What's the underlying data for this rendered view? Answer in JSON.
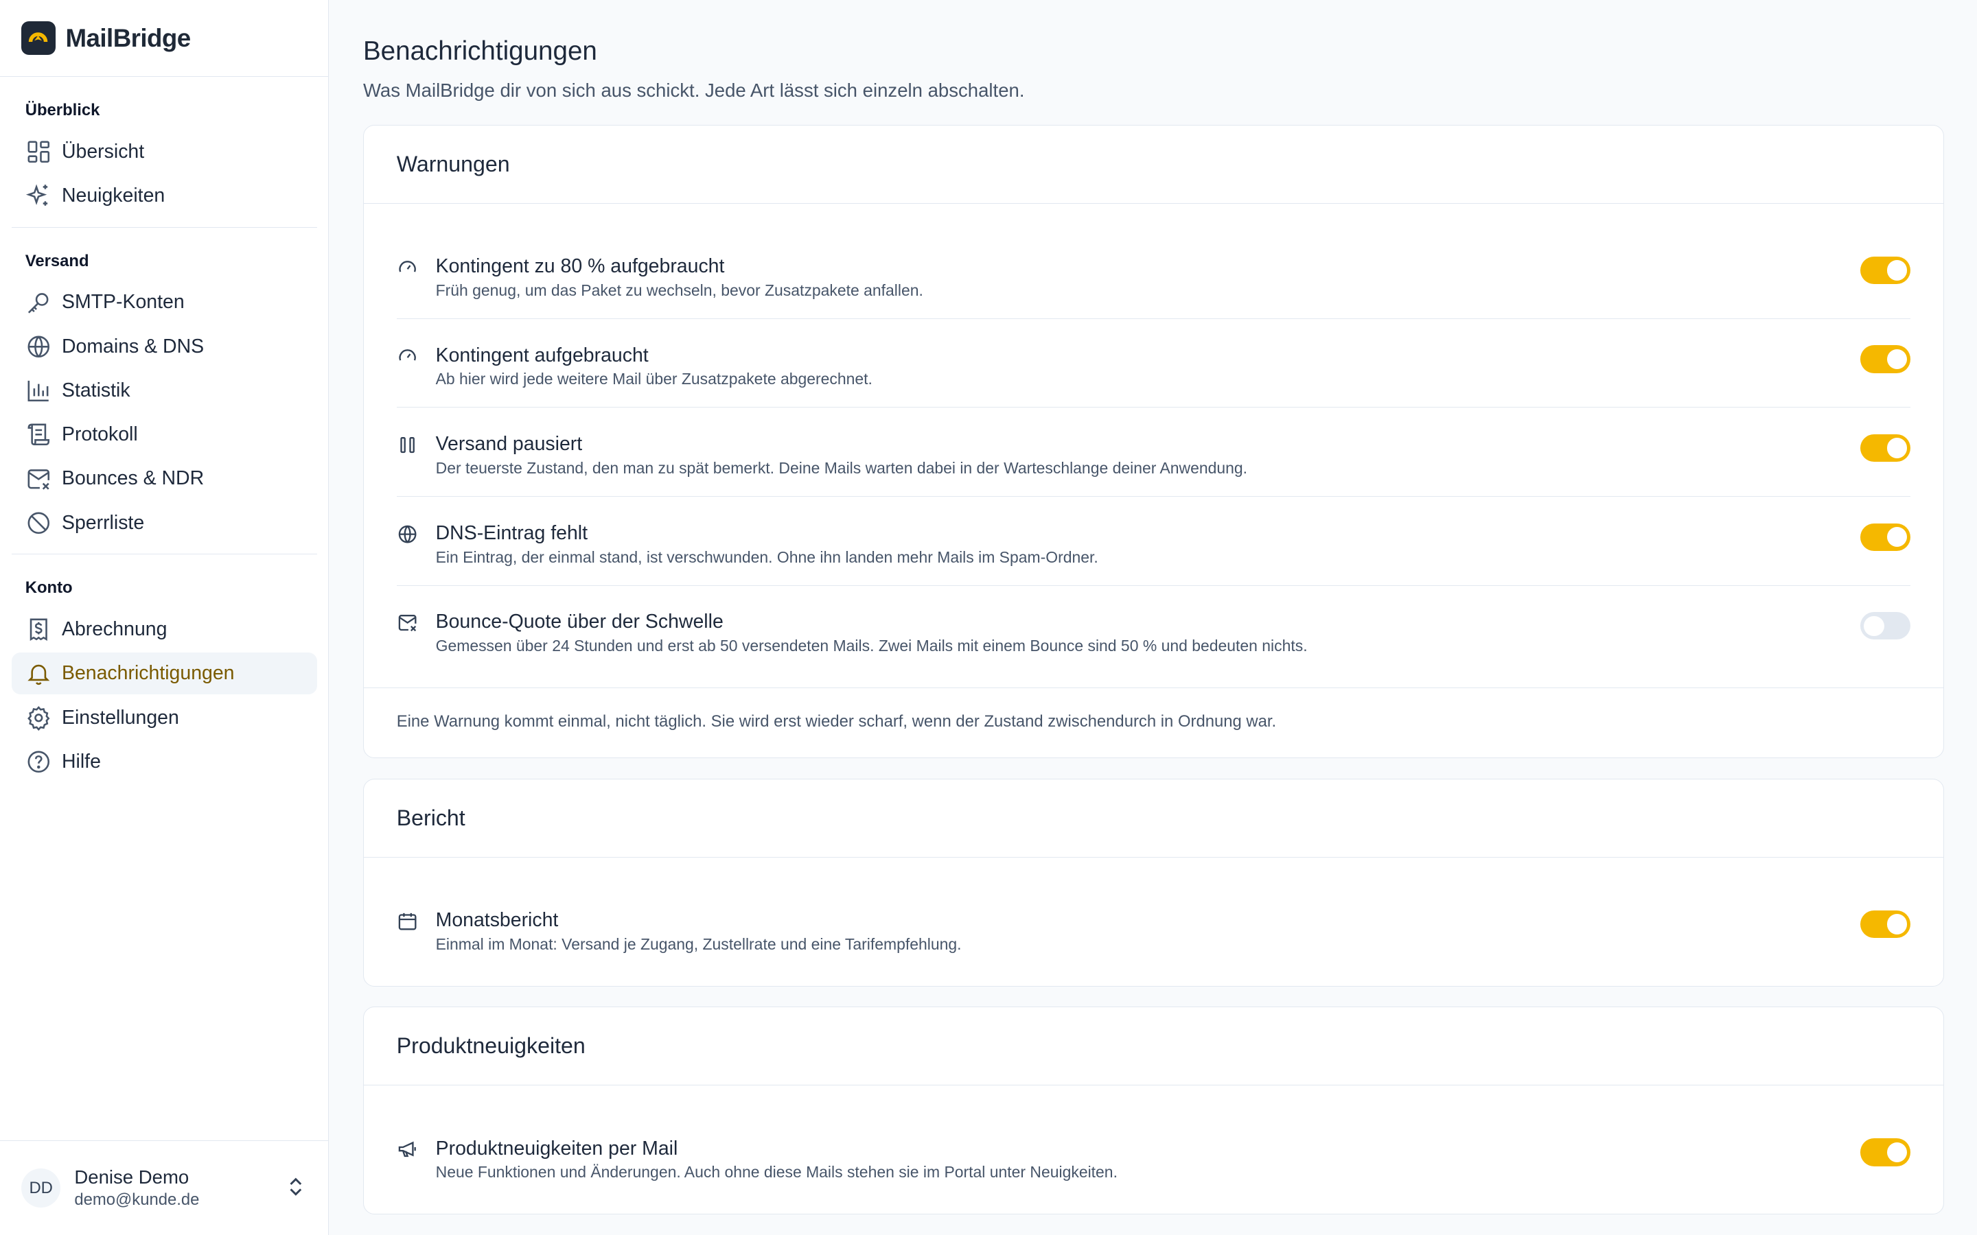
{
  "brand": {
    "name": "MailBridge"
  },
  "sidebar": {
    "groups": [
      {
        "heading": "Überblick",
        "items": [
          {
            "label": "Übersicht",
            "icon": "dashboard-icon"
          },
          {
            "label": "Neuigkeiten",
            "icon": "sparkles-icon"
          }
        ]
      },
      {
        "heading": "Versand",
        "items": [
          {
            "label": "SMTP-Konten",
            "icon": "key-icon"
          },
          {
            "label": "Domains & DNS",
            "icon": "globe-icon"
          },
          {
            "label": "Statistik",
            "icon": "bar-chart-icon"
          },
          {
            "label": "Protokoll",
            "icon": "scroll-icon"
          },
          {
            "label": "Bounces & NDR",
            "icon": "mail-x-icon"
          },
          {
            "label": "Sperrliste",
            "icon": "ban-icon"
          }
        ]
      },
      {
        "heading": "Konto",
        "items": [
          {
            "label": "Abrechnung",
            "icon": "receipt-dollar-icon"
          },
          {
            "label": "Benachrichtigungen",
            "icon": "bell-icon",
            "active": true
          },
          {
            "label": "Einstellungen",
            "icon": "gear-icon"
          },
          {
            "label": "Hilfe",
            "icon": "help-circle-icon"
          }
        ]
      }
    ]
  },
  "user": {
    "initials": "DD",
    "name": "Denise Demo",
    "email": "demo@kunde.de"
  },
  "page": {
    "title": "Benachrichtigungen",
    "subtitle": "Was MailBridge dir von sich aus schickt. Jede Art lässt sich einzeln abschalten."
  },
  "cards": [
    {
      "title": "Warnungen",
      "rows": [
        {
          "icon": "gauge-icon",
          "title": "Kontingent zu 80 % aufgebraucht",
          "desc": "Früh genug, um das Paket zu wechseln, bevor Zusatzpakete anfallen.",
          "enabled": true
        },
        {
          "icon": "gauge-icon",
          "title": "Kontingent aufgebraucht",
          "desc": "Ab hier wird jede weitere Mail über Zusatzpakete abgerechnet.",
          "enabled": true
        },
        {
          "icon": "pause-icon",
          "title": "Versand pausiert",
          "desc": "Der teuerste Zustand, den man zu spät bemerkt. Deine Mails warten dabei in der Warteschlange deiner Anwendung.",
          "enabled": true
        },
        {
          "icon": "globe-icon",
          "title": "DNS-Eintrag fehlt",
          "desc": "Ein Eintrag, der einmal stand, ist verschwunden. Ohne ihn landen mehr Mails im Spam-Ordner.",
          "enabled": true
        },
        {
          "icon": "mail-x-icon",
          "title": "Bounce-Quote über der Schwelle",
          "desc": "Gemessen über 24 Stunden und erst ab 50 versendeten Mails. Zwei Mails mit einem Bounce sind 50 % und bedeuten nichts.",
          "enabled": false
        }
      ],
      "footer": "Eine Warnung kommt einmal, nicht täglich. Sie wird erst wieder scharf, wenn der Zustand zwischendurch in Ordnung war."
    },
    {
      "title": "Bericht",
      "rows": [
        {
          "icon": "calendar-icon",
          "title": "Monatsbericht",
          "desc": "Einmal im Monat: Versand je Zugang, Zustellrate und eine Tarifempfehlung.",
          "enabled": true
        }
      ]
    },
    {
      "title": "Produktneuigkeiten",
      "rows": [
        {
          "icon": "megaphone-icon",
          "title": "Produktneuigkeiten per Mail",
          "desc": "Neue Funktionen und Änderungen. Auch ohne diese Mails stehen sie im Portal unter Neuigkeiten.",
          "enabled": true
        }
      ]
    }
  ],
  "colors": {
    "accent": "#f5b800",
    "active_text": "#7a5a00",
    "toggle_off": "#e2e8f0",
    "border": "#e2e8f0"
  }
}
